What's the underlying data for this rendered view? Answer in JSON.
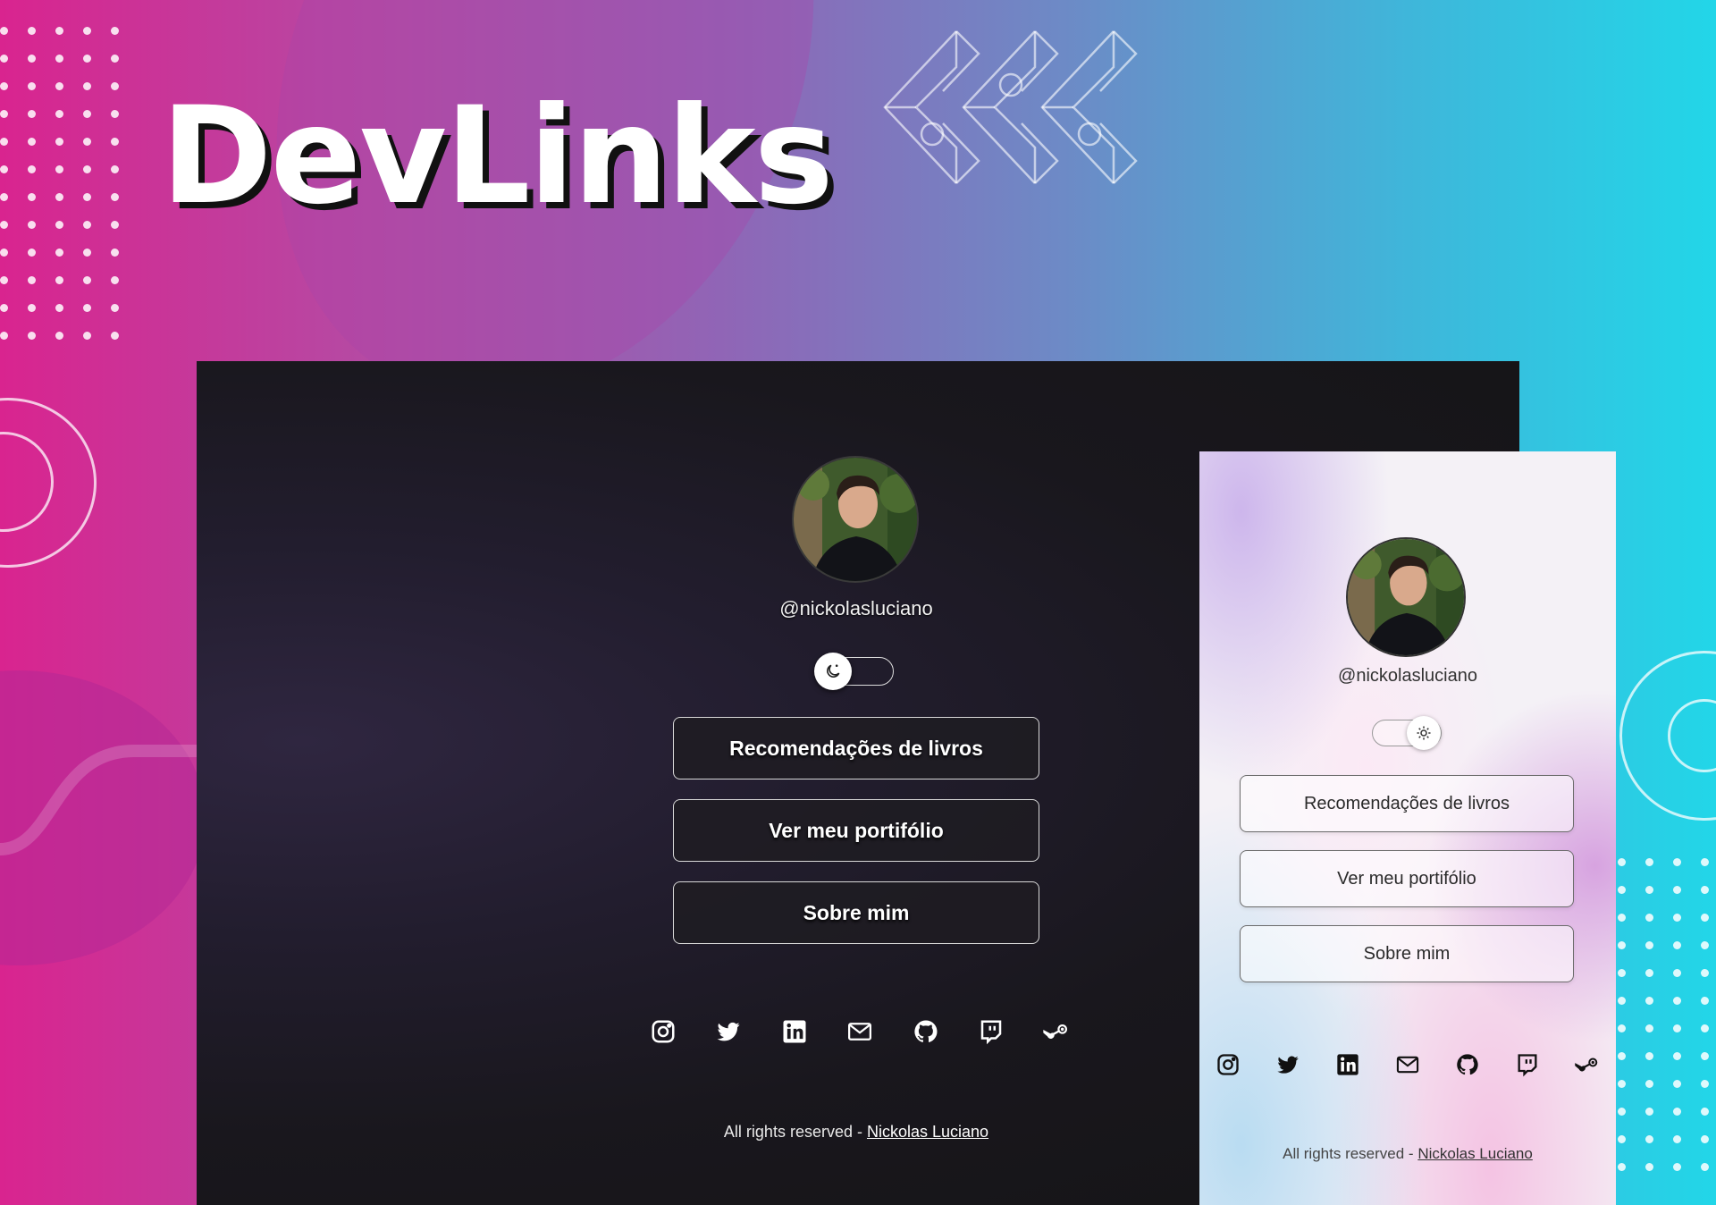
{
  "banner": {
    "title": "DevLinks"
  },
  "dark_view": {
    "username": "@nickolasluciano",
    "theme_icon": "moon-icon",
    "links": [
      {
        "label": "Recomendações de livros"
      },
      {
        "label": "Ver meu portifólio"
      },
      {
        "label": "Sobre mim"
      }
    ],
    "social_icons": [
      "instagram-icon",
      "twitter-icon",
      "linkedin-icon",
      "email-icon",
      "github-icon",
      "twitch-icon",
      "steam-icon"
    ],
    "footer_text": "All rights reserved - ",
    "footer_link": "Nickolas Luciano"
  },
  "light_view": {
    "username": "@nickolasluciano",
    "theme_icon": "sun-icon",
    "links": [
      {
        "label": "Recomendações de livros"
      },
      {
        "label": "Ver meu portifólio"
      },
      {
        "label": "Sobre mim"
      }
    ],
    "social_icons": [
      "instagram-icon",
      "twitter-icon",
      "linkedin-icon",
      "email-icon",
      "github-icon",
      "twitch-icon",
      "steam-icon"
    ],
    "footer_text": "All rights reserved - ",
    "footer_link": "Nickolas Luciano"
  },
  "colors": {
    "gradient_left": "#d9248f",
    "gradient_right": "#22d6e8",
    "dark_bg": "#19171d",
    "light_bg": "#f4f1f6"
  }
}
